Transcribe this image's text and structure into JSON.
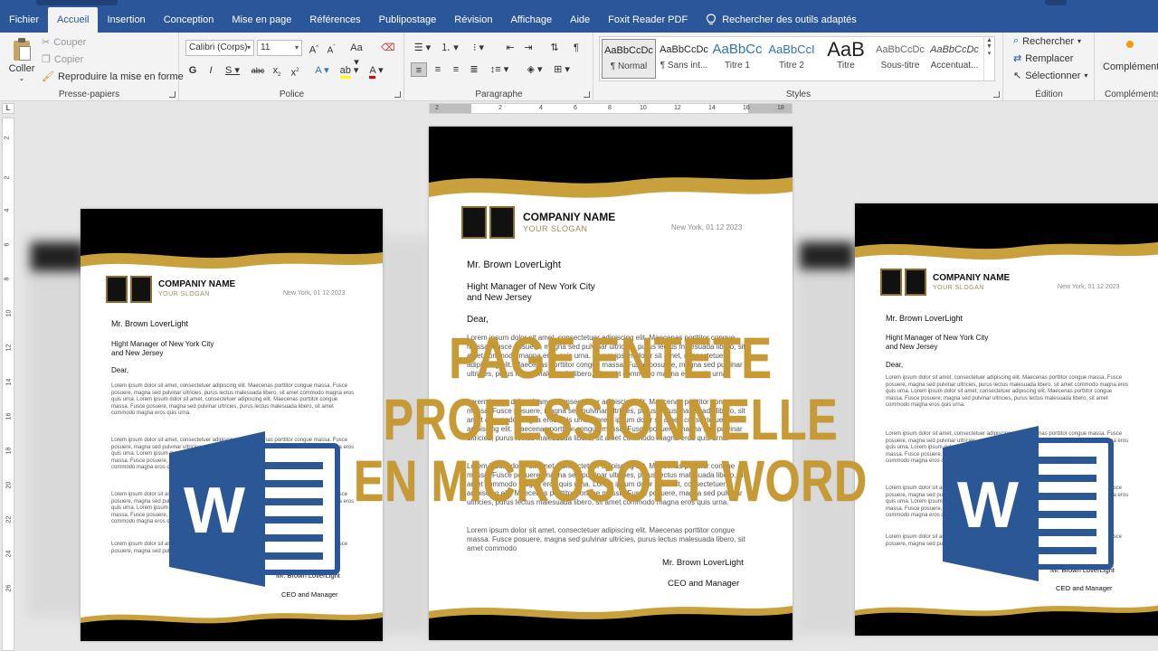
{
  "tabs": [
    "Fichier",
    "Accueil",
    "Insertion",
    "Conception",
    "Mise en page",
    "Références",
    "Publipostage",
    "Révision",
    "Affichage",
    "Aide",
    "Foxit Reader PDF"
  ],
  "active_tab": "Accueil",
  "search_tab": "Rechercher des outils adaptés",
  "clipboard": {
    "paste": "Coller",
    "cut": "Couper",
    "copy": "Copier",
    "format_painter": "Reproduire la mise en forme",
    "label": "Presse-papiers"
  },
  "font": {
    "name": "Calibri (Corps)",
    "size": "11",
    "label": "Police"
  },
  "paragraph": {
    "label": "Paragraphe"
  },
  "styles": {
    "label": "Styles",
    "items": [
      {
        "sample": "AaBbCcDc",
        "name": "¶ Normal"
      },
      {
        "sample": "AaBbCcDc",
        "name": "¶ Sans int..."
      },
      {
        "sample": "AaBbCc",
        "name": "Titre 1"
      },
      {
        "sample": "AaBbCcI",
        "name": "Titre 2"
      },
      {
        "sample": "AaB",
        "name": "Titre"
      },
      {
        "sample": "AaBbCcDc",
        "name": "Sous-titre"
      },
      {
        "sample": "AaBbCcDc",
        "name": "Accentuat..."
      }
    ]
  },
  "editing": {
    "find": "Rechercher",
    "replace": "Remplacer",
    "select": "Sélectionner",
    "label": "Édition"
  },
  "addins": {
    "button": "Compléments",
    "label": "Compléments"
  },
  "ruler_numbers": [
    "2",
    "2",
    "4",
    "6",
    "8",
    "10",
    "12",
    "14",
    "16",
    "18"
  ],
  "vruler_numbers": [
    "2",
    "2",
    "4",
    "6",
    "8",
    "10",
    "12",
    "14",
    "16",
    "18",
    "20",
    "22",
    "24",
    "26"
  ],
  "letter": {
    "company": "COMPANIY NAME",
    "slogan": "YOUR SLOGAN",
    "date": "New York, 01 12 2023",
    "recipient": "Mr. Brown LoverLight",
    "title_line1": "Hight Manager of New York City",
    "title_line2": "and New Jersey",
    "greeting": "Dear,",
    "para1": "Lorem ipsum dolor sit amet, consectetuer adipiscing elit. Maecenas porttitor congue massa. Fusce posuere, magna sed pulvinar ultricies, purus lectus malesuada libero, sit amet commodo magna eros quis urna. Lorem ipsum dolor sit amet, consectetuer adipiscing elit. Maecenas porttitor congue massa. Fusce posuere, magna sed pulvinar ultricies, purus lectus malesuada libero, sit amet commodo magna eros quis urna.",
    "para2": "Lorem ipsum dolor sit amet, consectetuer adipiscing elit. Maecenas porttitor congue massa. Fusce posuere, magna sed pulvinar ultricies, purus lectus malesuada libero, sit amet commodo magna eros quis urna. Lorem ipsum dolor sit amet, consectetuer adipiscing elit. Maecenas porttitor congue massa. Fusce posuere, magna sed pulvinar ultricies, purus lectus malesuada libero, sit amet commodo magna eros quis urna.",
    "para3": "Lorem ipsum dolor sit amet, consectetuer adipiscing elit. Maecenas porttitor congue massa. Fusce posuere, magna sed pulvinar ultricies, purus lectus malesuada libero, sit amet commodo magna eros quis urna. Lorem ipsum dolor sit amet, consectetuer adipiscing elit. Maecenas porttitor congue massa. Fusce posuere, magna sed pulvinar ultricies, purus lectus malesuada libero, sit amet commodo magna eros quis urna.",
    "para4": "Lorem ipsum dolor sit amet, consectetuer adipiscing elit. Maecenas porttitor congue massa. Fusce posuere, magna sed pulvinar ultricies, purus lectus malesuada libero, sit amet commodo",
    "signature_name": "Mr. Brown LoverLight",
    "signature_title": "CEO and Manager"
  },
  "overlay": {
    "line1": "PAGE ENTETE PROFESSIONNELLE",
    "line2": "EN MICROSOFT WORD"
  },
  "word_logo_letter": "W",
  "colors": {
    "ribbon_blue": "#2b579a",
    "gold": "#c79a33",
    "black": "#000000",
    "word_blue": "#2b5797"
  }
}
